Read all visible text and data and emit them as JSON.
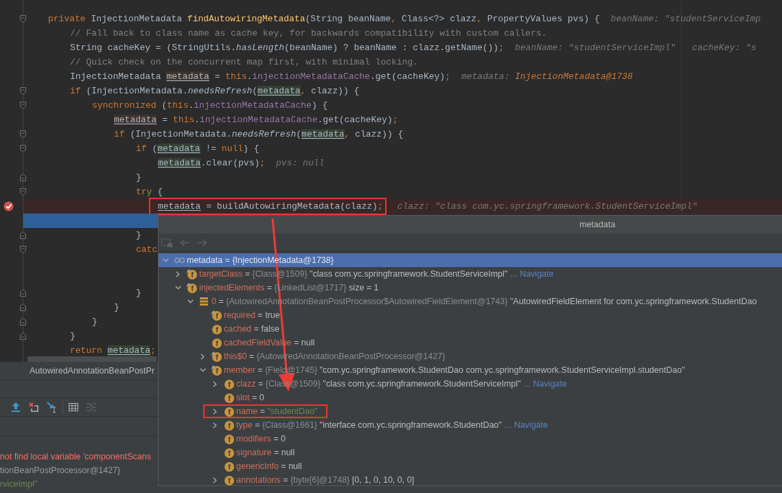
{
  "editor": {
    "lines": [
      {
        "kind": "code",
        "breakpoint": false,
        "execution_point": false,
        "marked": false,
        "tokens": [
          {
            "text": "private",
            "kind": "keyword"
          },
          {
            "text": " InjectionMetadata ",
            "kind": "plain"
          },
          {
            "text": "findAutowiringMetadata",
            "kind": "method"
          },
          {
            "text": "(String beanName",
            "kind": "plain"
          },
          {
            "text": ",",
            "kind": "punct"
          },
          {
            "text": " Class<?> clazz",
            "kind": "plain"
          },
          {
            "text": ",",
            "kind": "punct"
          },
          {
            "text": " PropertyValues pvs) {",
            "kind": "plain"
          }
        ],
        "hints": [
          {
            "label": "beanName:",
            "value": "\"studentServiceImp",
            "kind": "plain"
          }
        ],
        "children": [
          {
            "kind": "code",
            "breakpoint": false,
            "execution_point": false,
            "marked": false,
            "tokens": [
              {
                "text": "// Fall back to class name as cache key, for backwards compatibility with custom callers.",
                "kind": "comment"
              }
            ]
          },
          {
            "kind": "code",
            "breakpoint": false,
            "execution_point": false,
            "marked": false,
            "tokens": [
              {
                "text": "String cacheKey = (StringUtils.",
                "kind": "plain"
              },
              {
                "text": "hasLength",
                "kind": "static"
              },
              {
                "text": "(beanName) ? beanName : clazz.getName())",
                "kind": "plain"
              },
              {
                "text": ";",
                "kind": "punct"
              }
            ],
            "hints": [
              {
                "label": "beanName:",
                "value": "\"studentServiceImpl\"",
                "kind": "plain"
              },
              {
                "label": "cacheKey:",
                "value": "\"s",
                "kind": "plain"
              }
            ]
          },
          {
            "kind": "code",
            "breakpoint": false,
            "execution_point": false,
            "marked": false,
            "tokens": [
              {
                "text": "// Quick check on the concurrent map first, with minimal locking.",
                "kind": "comment"
              }
            ]
          },
          {
            "kind": "code",
            "breakpoint": false,
            "execution_point": false,
            "marked": false,
            "tokens": [
              {
                "text": "InjectionMetadata ",
                "kind": "plain"
              },
              {
                "text": "metadata",
                "kind": "var_write"
              },
              {
                "text": " = ",
                "kind": "plain"
              },
              {
                "text": "this",
                "kind": "keyword"
              },
              {
                "text": ".",
                "kind": "plain"
              },
              {
                "text": "injectionMetadataCache",
                "kind": "field"
              },
              {
                "text": ".get(cacheKey)",
                "kind": "plain"
              },
              {
                "text": ";",
                "kind": "punct"
              }
            ],
            "hints": [
              {
                "label": "metadata:",
                "value": "InjectionMetadata@1738",
                "kind": "object"
              }
            ]
          },
          {
            "kind": "code",
            "breakpoint": false,
            "execution_point": false,
            "marked": false,
            "tokens": [
              {
                "text": "if",
                "kind": "keyword"
              },
              {
                "text": " (InjectionMetadata.",
                "kind": "plain"
              },
              {
                "text": "needsRefresh",
                "kind": "static"
              },
              {
                "text": "(",
                "kind": "plain"
              },
              {
                "text": "metadata",
                "kind": "var_read"
              },
              {
                "text": ",",
                "kind": "punct"
              },
              {
                "text": " clazz)) {",
                "kind": "plain"
              }
            ],
            "children": [
              {
                "kind": "code",
                "breakpoint": false,
                "execution_point": false,
                "marked": false,
                "tokens": [
                  {
                    "text": "synchronized",
                    "kind": "keyword"
                  },
                  {
                    "text": " (",
                    "kind": "plain"
                  },
                  {
                    "text": "this",
                    "kind": "keyword"
                  },
                  {
                    "text": ".",
                    "kind": "plain"
                  },
                  {
                    "text": "injectionMetadataCache",
                    "kind": "field"
                  },
                  {
                    "text": ") {",
                    "kind": "plain"
                  }
                ],
                "children": [
                  {
                    "kind": "code",
                    "breakpoint": false,
                    "execution_point": false,
                    "marked": false,
                    "tokens": [
                      {
                        "text": "metadata",
                        "kind": "var_write"
                      },
                      {
                        "text": " = ",
                        "kind": "plain"
                      },
                      {
                        "text": "this",
                        "kind": "keyword"
                      },
                      {
                        "text": ".",
                        "kind": "plain"
                      },
                      {
                        "text": "injectionMetadataCache",
                        "kind": "field"
                      },
                      {
                        "text": ".get(cacheKey)",
                        "kind": "plain"
                      },
                      {
                        "text": ";",
                        "kind": "punct"
                      }
                    ]
                  },
                  {
                    "kind": "code",
                    "breakpoint": false,
                    "execution_point": false,
                    "marked": false,
                    "tokens": [
                      {
                        "text": "if",
                        "kind": "keyword"
                      },
                      {
                        "text": " (InjectionMetadata.",
                        "kind": "plain"
                      },
                      {
                        "text": "needsRefresh",
                        "kind": "static"
                      },
                      {
                        "text": "(",
                        "kind": "plain"
                      },
                      {
                        "text": "metadata",
                        "kind": "var_read"
                      },
                      {
                        "text": ",",
                        "kind": "punct"
                      },
                      {
                        "text": " clazz)) {",
                        "kind": "plain"
                      }
                    ],
                    "children": [
                      {
                        "kind": "code",
                        "breakpoint": false,
                        "execution_point": false,
                        "marked": false,
                        "tokens": [
                          {
                            "text": "if",
                            "kind": "keyword"
                          },
                          {
                            "text": " (",
                            "kind": "plain"
                          },
                          {
                            "text": "metadata",
                            "kind": "var_read"
                          },
                          {
                            "text": " != ",
                            "kind": "plain"
                          },
                          {
                            "text": "null",
                            "kind": "keyword"
                          },
                          {
                            "text": ") {",
                            "kind": "plain"
                          }
                        ],
                        "children": [
                          {
                            "kind": "code",
                            "breakpoint": false,
                            "execution_point": false,
                            "marked": false,
                            "tokens": [
                              {
                                "text": "metadata",
                                "kind": "var_read"
                              },
                              {
                                "text": ".clear(pvs)",
                                "kind": "plain"
                              },
                              {
                                "text": ";",
                                "kind": "punct"
                              }
                            ],
                            "hints": [
                              {
                                "label": "pvs:",
                                "value": "null",
                                "kind": "plain"
                              }
                            ]
                          }
                        ]
                      },
                      {
                        "kind": "code",
                        "breakpoint": false,
                        "execution_point": false,
                        "marked": false,
                        "tokens": [
                          {
                            "text": "}",
                            "kind": "plain"
                          }
                        ]
                      },
                      {
                        "kind": "code",
                        "breakpoint": false,
                        "execution_point": false,
                        "marked": false,
                        "tokens": [
                          {
                            "text": "try",
                            "kind": "keyword"
                          },
                          {
                            "text": " {",
                            "kind": "plain"
                          }
                        ],
                        "children": [
                          {
                            "kind": "code",
                            "breakpoint": true,
                            "execution_point": false,
                            "marked": true,
                            "tokens": [
                              {
                                "text": "metadata",
                                "kind": "var"
                              },
                              {
                                "text": " = buildAutowiringMetadata(clazz)",
                                "kind": "plain"
                              },
                              {
                                "text": ";",
                                "kind": "punct"
                              }
                            ],
                            "hints": [
                              {
                                "label": "clazz:",
                                "value": "\"class com.yc.springframework.StudentServiceImpl\"",
                                "kind": "plain"
                              }
                            ]
                          },
                          {
                            "kind": "covered",
                            "breakpoint": false,
                            "execution_point": true,
                            "marked": false
                          }
                        ]
                      },
                      {
                        "kind": "code",
                        "breakpoint": false,
                        "execution_point": false,
                        "marked": false,
                        "tokens": [
                          {
                            "text": "}",
                            "kind": "plain"
                          }
                        ]
                      },
                      {
                        "kind": "code",
                        "breakpoint": false,
                        "execution_point": false,
                        "marked": false,
                        "tokens": [
                          {
                            "text": "catc",
                            "kind": "keyword"
                          }
                        ],
                        "children": [
                          {
                            "kind": "covered",
                            "breakpoint": false,
                            "execution_point": false,
                            "marked": false
                          },
                          {
                            "kind": "covered",
                            "breakpoint": false,
                            "execution_point": false,
                            "marked": false
                          }
                        ]
                      },
                      {
                        "kind": "code",
                        "breakpoint": false,
                        "execution_point": false,
                        "marked": false,
                        "tokens": [
                          {
                            "text": "}",
                            "kind": "plain"
                          }
                        ]
                      }
                    ]
                  },
                  {
                    "kind": "code",
                    "breakpoint": false,
                    "execution_point": false,
                    "marked": false,
                    "tokens": [
                      {
                        "text": "}",
                        "kind": "plain"
                      }
                    ]
                  }
                ]
              },
              {
                "kind": "code",
                "breakpoint": false,
                "execution_point": false,
                "marked": false,
                "tokens": [
                  {
                    "text": "}",
                    "kind": "plain"
                  }
                ]
              }
            ]
          },
          {
            "kind": "code",
            "breakpoint": false,
            "execution_point": false,
            "marked": false,
            "tokens": [
              {
                "text": "}",
                "kind": "plain"
              }
            ]
          },
          {
            "kind": "code",
            "breakpoint": false,
            "execution_point": false,
            "marked": false,
            "tokens": [
              {
                "text": "return ",
                "kind": "keyword"
              },
              {
                "text": "metadata",
                "kind": "var_read"
              },
              {
                "text": ";",
                "kind": "punct"
              }
            ]
          }
        ]
      }
    ]
  },
  "breadcrumb": "AutowiredAnnotationBeanPostPr",
  "debug_toolbar": {
    "groups": [
      {
        "buttons": [
          {
            "kind": "step_out",
            "disabled": false
          },
          {
            "kind": "drop_frame",
            "disabled": false
          },
          {
            "kind": "run_to_cursor",
            "disabled": false
          }
        ]
      },
      {
        "buttons": [
          {
            "kind": "table",
            "disabled": false
          },
          {
            "kind": "trace",
            "disabled": true
          }
        ]
      }
    ]
  },
  "variables": [
    {
      "text": "not find local variable 'componentScans",
      "kind": "error"
    },
    {
      "text": "tionBeanPostProcessor@1427}",
      "kind": "ref"
    },
    {
      "text": "rviceImpl\"",
      "kind": "string"
    }
  ],
  "popup": {
    "title": "metadata",
    "toolbar": [
      {
        "kind": "folder",
        "disabled": true
      },
      {
        "kind": "back",
        "disabled": true
      },
      {
        "kind": "forward",
        "disabled": true
      }
    ],
    "tree": [
      {
        "kind": "watch",
        "final": false,
        "name": "metadata",
        "op": "=",
        "ref": "{InjectionMetadata@1738}",
        "expanded": true,
        "selected": true,
        "marked": false,
        "children": [
          {
            "kind": "field",
            "icon_letter": "f",
            "final": true,
            "name": "targetClass",
            "op": "=",
            "ref": "{Class@1509}",
            "value": {
              "text": "\"class com.yc.springframework.StudentServiceImpl\"",
              "kind": "plain"
            },
            "link": "... Navigate",
            "expanded": false,
            "selected": false,
            "marked": false
          },
          {
            "kind": "field",
            "icon_letter": "f",
            "final": true,
            "name": "injectedElements",
            "op": "=",
            "ref": "{LinkedList@1717}",
            "value": {
              "text": "size = 1",
              "kind": "plain"
            },
            "expanded": true,
            "selected": false,
            "marked": false,
            "children": [
              {
                "kind": "element",
                "final": false,
                "name": "0",
                "op": "=",
                "ref": "{AutowiredAnnotationBeanPostProcessor$AutowiredFieldElement@1743}",
                "value": {
                  "text": "\"AutowiredFieldElement for com.yc.springframework.StudentDao",
                  "kind": "plain"
                },
                "expanded": true,
                "selected": false,
                "marked": false,
                "children": [
                  {
                    "kind": "field",
                    "icon_letter": "f",
                    "final": true,
                    "name": "required",
                    "op": "=",
                    "value": {
                      "text": "true",
                      "kind": "plain"
                    },
                    "selected": false,
                    "marked": false
                  },
                  {
                    "kind": "field",
                    "icon_letter": "f",
                    "final": false,
                    "name": "cached",
                    "op": "=",
                    "value": {
                      "text": "false",
                      "kind": "plain"
                    },
                    "selected": false,
                    "marked": false
                  },
                  {
                    "kind": "field",
                    "icon_letter": "f",
                    "final": false,
                    "name": "cachedFieldValue",
                    "op": "=",
                    "value": {
                      "text": "null",
                      "kind": "plain"
                    },
                    "selected": false,
                    "marked": false
                  },
                  {
                    "kind": "field",
                    "icon_letter": "f",
                    "final": true,
                    "name": "this$0",
                    "op": "=",
                    "ref": "{AutowiredAnnotationBeanPostProcessor@1427}",
                    "expanded": false,
                    "selected": false,
                    "marked": false
                  },
                  {
                    "kind": "field",
                    "icon_letter": "f",
                    "final": true,
                    "name": "member",
                    "op": "=",
                    "ref": "{Field@1745}",
                    "value": {
                      "text": "\"com.yc.springframework.StudentDao com.yc.springframework.StudentServiceImpl.studentDao\"",
                      "kind": "plain"
                    },
                    "expanded": true,
                    "selected": false,
                    "marked": false,
                    "children": [
                      {
                        "kind": "field",
                        "icon_letter": "f",
                        "final": false,
                        "name": "clazz",
                        "op": "=",
                        "ref": "{Class@1509}",
                        "value": {
                          "text": "\"class com.yc.springframework.StudentServiceImpl\"",
                          "kind": "plain"
                        },
                        "link": "... Navigate",
                        "expanded": false,
                        "selected": false,
                        "marked": false
                      },
                      {
                        "kind": "field",
                        "icon_letter": "f",
                        "final": false,
                        "name": "slot",
                        "op": "=",
                        "value": {
                          "text": "0",
                          "kind": "plain"
                        },
                        "selected": false,
                        "marked": false
                      },
                      {
                        "kind": "field",
                        "icon_letter": "f",
                        "final": false,
                        "name": "name",
                        "op": "=",
                        "value": {
                          "text": "\"studentDao\"",
                          "kind": "string"
                        },
                        "expanded": false,
                        "selected": false,
                        "marked": true
                      },
                      {
                        "kind": "field",
                        "icon_letter": "f",
                        "final": false,
                        "name": "type",
                        "op": "=",
                        "ref": "{Class@1661}",
                        "value": {
                          "text": "\"interface com.yc.springframework.StudentDao\"",
                          "kind": "plain"
                        },
                        "link": "... Navigate",
                        "expanded": false,
                        "selected": false,
                        "marked": false
                      },
                      {
                        "kind": "field",
                        "icon_letter": "f",
                        "final": false,
                        "name": "modifiers",
                        "op": "=",
                        "value": {
                          "text": "0",
                          "kind": "plain"
                        },
                        "selected": false,
                        "marked": false
                      },
                      {
                        "kind": "field",
                        "icon_letter": "f",
                        "final": false,
                        "name": "signature",
                        "op": "=",
                        "value": {
                          "text": "null",
                          "kind": "plain"
                        },
                        "selected": false,
                        "marked": false
                      },
                      {
                        "kind": "field",
                        "icon_letter": "f",
                        "final": false,
                        "name": "genericInfo",
                        "op": "=",
                        "value": {
                          "text": "null",
                          "kind": "plain"
                        },
                        "selected": false,
                        "marked": false
                      },
                      {
                        "kind": "field",
                        "icon_letter": "f",
                        "final": false,
                        "name": "annotations",
                        "op": "=",
                        "ref": "{byte[6]@1748}",
                        "value": {
                          "text": "[0, 1, 0, 10, 0, 0]",
                          "kind": "plain"
                        },
                        "expanded": false,
                        "selected": false,
                        "marked": false
                      }
                    ]
                  }
                ]
              }
            ]
          }
        ]
      }
    ]
  },
  "annotations": [
    {
      "kind": "arrow"
    }
  ]
}
